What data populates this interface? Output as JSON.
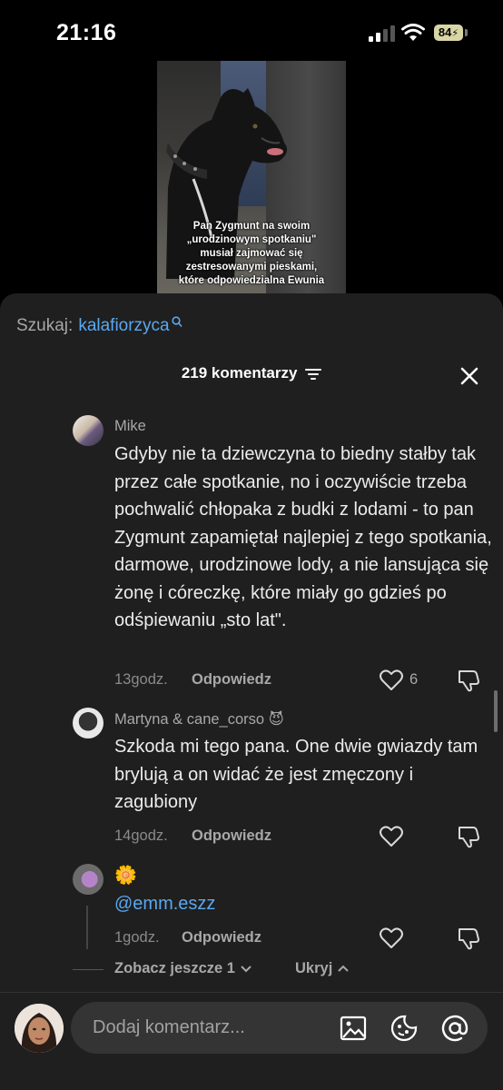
{
  "status": {
    "time": "21:16",
    "battery": "84"
  },
  "video": {
    "caption": "Pan Zygmunt na swoim\n„urodzinowym spotkaniu\"\nmusiał zajmować się\nzestresowanymi pieskami,\nktóre odpowiedzialna Ewunia"
  },
  "search": {
    "label": "Szukaj:",
    "term": "kalafiorzyca"
  },
  "header": {
    "title": "219 komentarzy"
  },
  "comments": [
    {
      "username": "Mike",
      "text": "Gdyby nie ta dziewczyna to biedny stałby tak przez całe spotkanie, no i oczywiście trzeba pochwalić chłopaka z budki z lodami - to pan Zygmunt zapamiętał najlepiej z tego spotkania, darmowe, urodzinowe lody, a nie lansująca się żonę i córeczkę, które miały go gdzieś po odśpiewaniu „sto lat\".",
      "time": "13godz.",
      "reply": "Odpowiedz",
      "likes": "6"
    },
    {
      "username": "Martyna & cane_corso 😈",
      "text": "Szkoda mi tego pana. One dwie gwiazdy tam brylują a on widać że jest zmęczony i zagubiony",
      "time": "14godz.",
      "reply": "Odpowiedz",
      "likes": ""
    },
    {
      "username": "🌼",
      "text": "@emm.eszz",
      "time": "1godz.",
      "reply": "Odpowiedz",
      "likes": ""
    }
  ],
  "thread": {
    "view_more": "Zobacz jeszcze 1",
    "hide": "Ukryj"
  },
  "input": {
    "placeholder": "Dodaj komentarz..."
  },
  "colors": {
    "accent": "#5aa8f0",
    "sheet": "#1f1f1f"
  }
}
